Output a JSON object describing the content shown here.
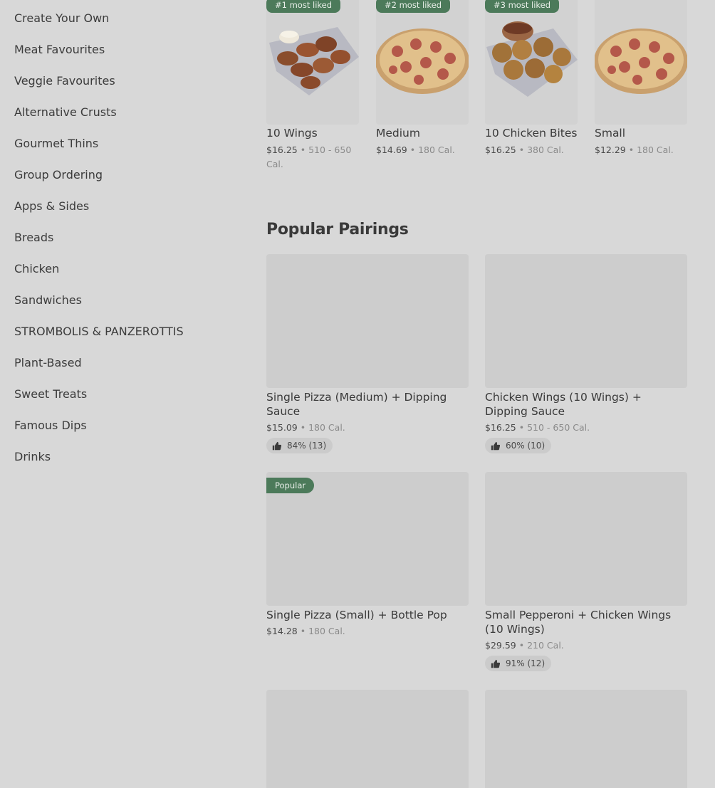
{
  "sidebar": {
    "items": [
      {
        "label": "Create Your Own"
      },
      {
        "label": "Meat Favourites"
      },
      {
        "label": "Veggie Favourites"
      },
      {
        "label": "Alternative Crusts"
      },
      {
        "label": "Gourmet Thins"
      },
      {
        "label": "Group Ordering"
      },
      {
        "label": "Apps & Sides"
      },
      {
        "label": "Breads"
      },
      {
        "label": "Chicken"
      },
      {
        "label": "Sandwiches"
      },
      {
        "label": "STROMBOLIS & PANZEROTTIS"
      },
      {
        "label": "Plant-Based"
      },
      {
        "label": "Sweet Treats"
      },
      {
        "label": "Famous Dips"
      },
      {
        "label": "Drinks"
      }
    ]
  },
  "most_liked": [
    {
      "badge": "#1 most liked",
      "title": "10 Wings",
      "price": "$16.25",
      "cal": "510 - 650 Cal.",
      "image": "wings-image"
    },
    {
      "badge": "#2 most liked",
      "title": "Medium",
      "price": "$14.69",
      "cal": "180 Cal.",
      "image": "pizza-image"
    },
    {
      "badge": "#3 most liked",
      "title": "10 Chicken Bites",
      "price": "$16.25",
      "cal": "380 Cal.",
      "image": "chicken-bites-image"
    },
    {
      "badge": "",
      "title": "Small",
      "price": "$12.29",
      "cal": "180 Cal.",
      "image": "pizza-image"
    }
  ],
  "pairings": {
    "title": "Popular Pairings",
    "items": [
      {
        "badge": "",
        "title": "Single Pizza (Medium) + Dipping Sauce",
        "price": "$15.09",
        "cal": "180 Cal.",
        "rating": "84% (13)"
      },
      {
        "badge": "",
        "title": "Chicken Wings (10 Wings) + Dipping Sauce",
        "price": "$16.25",
        "cal": "510 - 650 Cal.",
        "rating": "60% (10)"
      },
      {
        "badge": "Popular",
        "title": "Single Pizza (Small) + Bottle Pop",
        "price": "$14.28",
        "cal": "180 Cal.",
        "rating": ""
      },
      {
        "badge": "",
        "title": "Small Pepperoni + Chicken Wings (10 Wings)",
        "price": "$29.59",
        "cal": "210 Cal.",
        "rating": "91% (12)"
      }
    ]
  },
  "separator": "•",
  "colors": {
    "badge": "#4c7a5a",
    "overlay": "#d8d8d8"
  }
}
